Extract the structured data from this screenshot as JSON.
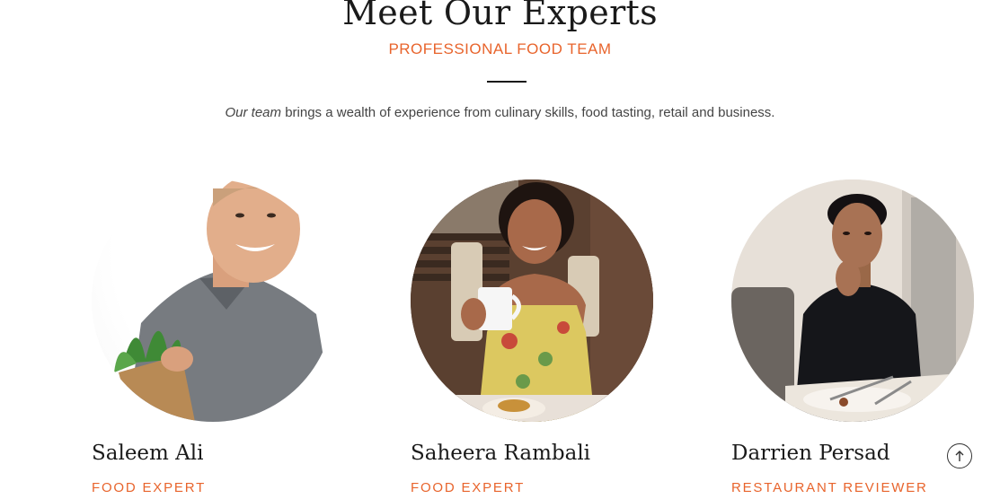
{
  "section": {
    "title": "Meet Our Experts",
    "subtitle": "PROFESSIONAL FOOD TEAM",
    "intro_em": "Our team",
    "intro_rest": " brings a wealth of experience from culinary skills, food tasting, retail and business."
  },
  "experts": [
    {
      "name": "Saleem Ali",
      "role": "FOOD EXPERT"
    },
    {
      "name": "Saheera Rambali",
      "role": "FOOD EXPERT"
    },
    {
      "name": "Darrien Persad",
      "role": "RESTAURANT REVIEWER"
    }
  ],
  "icons": {
    "scroll_top": "arrow-up-icon"
  },
  "colors": {
    "accent": "#e8642c",
    "text_dark": "#1a1a1a",
    "background": "#ffffff"
  }
}
